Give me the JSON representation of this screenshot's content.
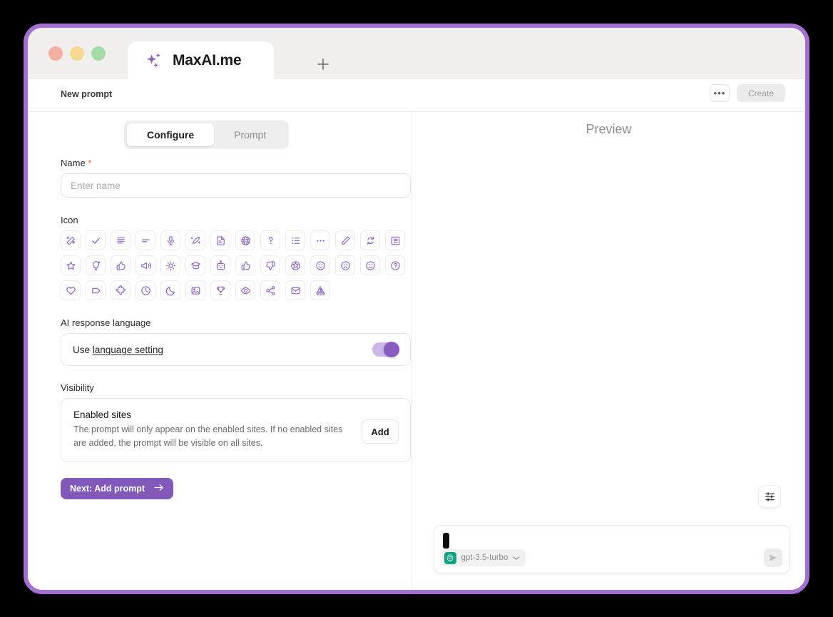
{
  "window": {
    "traffic_lights": [
      "close",
      "minimize",
      "maximize"
    ],
    "border_color": "#a46fd4"
  },
  "browser": {
    "tab": {
      "title": "MaxAI.me",
      "icon": "sparkle-icon"
    },
    "new_tab_label": "+"
  },
  "page_header": {
    "title": "New prompt",
    "more_label": "•••",
    "create_label": "Create",
    "create_disabled": true
  },
  "tabs": {
    "items": [
      {
        "label": "Configure",
        "active": true
      },
      {
        "label": "Prompt",
        "active": false
      }
    ]
  },
  "form": {
    "name": {
      "label": "Name",
      "required_marker": "*",
      "value": "",
      "placeholder": "Enter name"
    },
    "icon": {
      "label": "Icon",
      "selected_index": 0,
      "options": [
        "magic-wand-icon",
        "check-icon",
        "align-justify-icon",
        "align-left-icon",
        "microphone-icon",
        "magic-pen-icon",
        "file-text-icon",
        "globe-icon",
        "question-mark-icon",
        "list-icon",
        "ellipsis-icon",
        "pencil-icon",
        "refresh-icon",
        "table-icon",
        "star-icon",
        "lightbulb-icon",
        "thumbs-up-outline-icon",
        "megaphone-icon",
        "sun-icon",
        "graduation-cap-icon",
        "robot-icon",
        "thumbs-up-icon",
        "thumbs-down-icon",
        "soccer-ball-icon",
        "smile-icon",
        "frown-icon",
        "neutral-face-icon",
        "question-circle-icon",
        "heart-icon",
        "tag-icon",
        "puzzle-icon",
        "clock-icon",
        "moon-icon",
        "image-icon",
        "trophy-icon",
        "eye-icon",
        "share-icon",
        "mail-icon",
        "sailboat-icon"
      ]
    },
    "language": {
      "label": "AI response language",
      "row_prefix": "Use ",
      "row_link": "language setting",
      "toggle_on": true,
      "toggle_color": "#8a5cc0"
    },
    "visibility": {
      "label": "Visibility",
      "card_title": "Enabled sites",
      "card_desc": "The prompt will only appear on the enabled sites. If no enabled sites are added, the prompt will be visible on all sites.",
      "add_label": "Add"
    },
    "next_button": {
      "label": "Next: Add prompt",
      "arrow": "→",
      "color": "#8358bb"
    }
  },
  "preview": {
    "title": "Preview",
    "settings_icon": "sliders-icon",
    "composer": {
      "input_value": "",
      "model_name": "gpt-3.5-turbo",
      "model_icon": "openai-logo-icon",
      "model_icon_color": "#10a37f",
      "chevron": "chevron-down-icon",
      "send_icon": "send-icon",
      "send_disabled": true
    }
  }
}
